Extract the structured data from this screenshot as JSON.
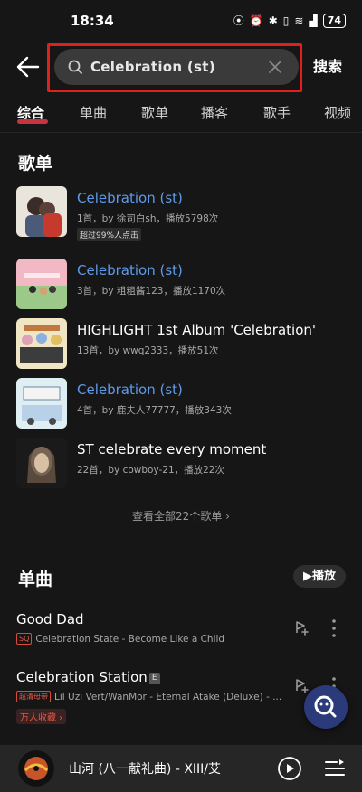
{
  "status": {
    "time": "18:34",
    "battery": "74"
  },
  "search": {
    "query": "Celebration (st)",
    "button": "搜索"
  },
  "tabs": [
    "综合",
    "单曲",
    "歌单",
    "播客",
    "歌手",
    "视频"
  ],
  "playlists": {
    "title": "歌单",
    "items": [
      {
        "title": "Celebration (st)",
        "meta": "1首，by 徐司白sh，播放5798次",
        "badge": "超过99%人点击"
      },
      {
        "title": "Celebration (st)",
        "meta": "3首，by 粗粗酱123，播放1170次"
      },
      {
        "title": "HIGHLIGHT 1st Album 'Celebration'",
        "meta": "13首，by wwq2333，播放51次"
      },
      {
        "title": "Celebration (st)",
        "meta": "4首，by 鹿夫人77777，播放343次"
      },
      {
        "title": "ST celebrate every moment",
        "meta": "22首，by cowboy-21，播放22次"
      }
    ],
    "view_all": "查看全部22个歌单 ›"
  },
  "songs": {
    "title": "单曲",
    "play_all": "▶播放",
    "items": [
      {
        "title": "Good Dad",
        "tag": "SQ",
        "subtitle": "Celebration State - Become Like a Child"
      },
      {
        "title": "Celebration Station",
        "explicit": "E",
        "tag": "超清母带",
        "subtitle": "Lil Uzi Vert/WanMor - Eternal Atake (Deluxe) - ...",
        "favorite": "万人收藏 ›"
      }
    ]
  },
  "mini_player": {
    "title": "山河 (八一献礼曲) - XIII/艾"
  },
  "colors": {
    "background": "#161616",
    "accent": "#e8384a",
    "link_blue": "#5f9ae8",
    "highlight_red": "#e0201e"
  }
}
